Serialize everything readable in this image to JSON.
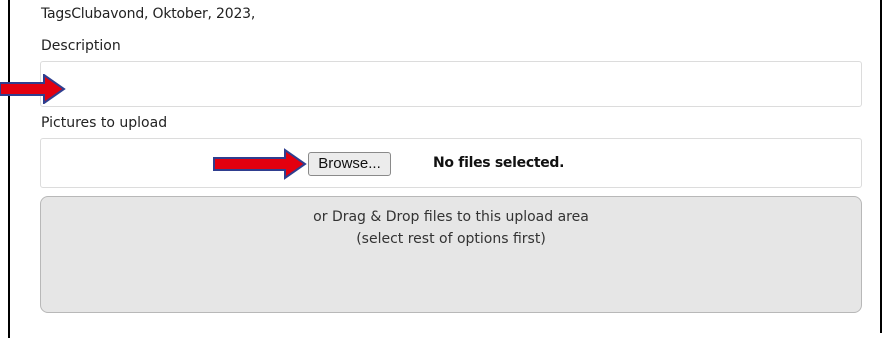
{
  "tags_line": "TagsClubavond, Oktober, 2023,",
  "description": {
    "label": "Description",
    "value": ""
  },
  "pictures": {
    "label": "Pictures to upload",
    "browse_label": "Browse...",
    "status": "No files selected."
  },
  "drop_area": {
    "line1": "or Drag & Drop files to this upload area",
    "line2": "(select rest of options first)"
  },
  "colors": {
    "arrow_fill": "#e3000f",
    "arrow_outline": "#2f3e8f",
    "drop_area_bg": "#e6e6e6"
  },
  "icons": [
    "red-arrow-icon"
  ]
}
